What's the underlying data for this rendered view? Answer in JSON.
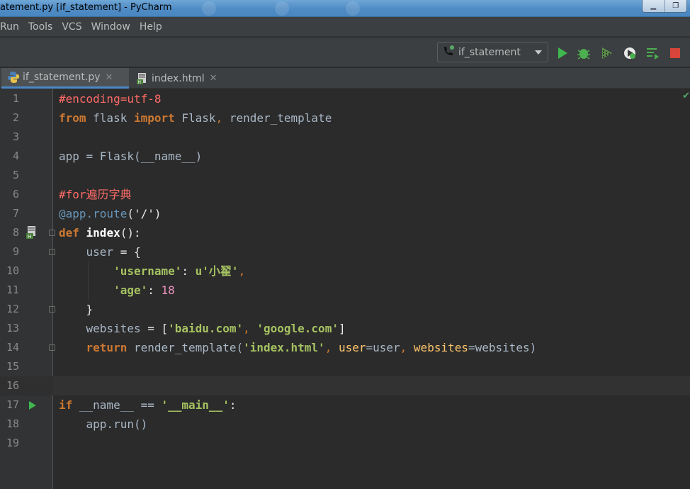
{
  "window": {
    "title": "atement.py [if_statement] - PyCharm",
    "controls": [
      "minimize",
      "restore"
    ]
  },
  "menu": [
    "Run",
    "Tools",
    "VCS",
    "Window",
    "Help"
  ],
  "toolbar": {
    "run_config": "if_statement",
    "icons": [
      "run-icon",
      "debug-icon",
      "coverage-icon",
      "profile-icon",
      "concurrency-icon",
      "stop-icon"
    ]
  },
  "tabs": [
    {
      "label": "if_statement.py",
      "active": true,
      "icon": "python-file-icon"
    },
    {
      "label": "index.html",
      "active": false,
      "icon": "html-file-icon"
    }
  ],
  "editor": {
    "current_line": 16,
    "lines": [
      {
        "n": "1",
        "tokens": [
          {
            "t": "#encoding=utf-8",
            "c": "cmt"
          }
        ]
      },
      {
        "n": "2",
        "tokens": [
          {
            "t": "from",
            "c": "kw"
          },
          {
            "t": " flask ",
            "c": "plain"
          },
          {
            "t": "import",
            "c": "kw"
          },
          {
            "t": " Flask",
            "c": "plain"
          },
          {
            "t": ", ",
            "c": "kw0"
          },
          {
            "t": "render_template",
            "c": "plain"
          }
        ]
      },
      {
        "n": "3",
        "tokens": []
      },
      {
        "n": "4",
        "tokens": [
          {
            "t": "app = Flask(__name__)",
            "c": "plain"
          }
        ]
      },
      {
        "n": "5",
        "tokens": []
      },
      {
        "n": "6",
        "tokens": [
          {
            "t": "#for遍历字典",
            "c": "cmt"
          }
        ]
      },
      {
        "n": "7",
        "tokens": [
          {
            "t": "@app.route",
            "c": "dec"
          },
          {
            "t": "('/')",
            "c": "plain2"
          }
        ]
      },
      {
        "n": "8",
        "tokens": [
          {
            "t": "def",
            "c": "kw"
          },
          {
            "t": " index",
            "c": "fnb"
          },
          {
            "t": "():",
            "c": "plain2"
          }
        ]
      },
      {
        "n": "9",
        "tokens": [
          {
            "t": "    user",
            "c": "plain"
          },
          {
            "t": " = {",
            "c": "plain2"
          }
        ]
      },
      {
        "n": "10",
        "tokens": [
          {
            "t": "        ",
            "c": "plain"
          },
          {
            "t": "'username'",
            "c": "strb"
          },
          {
            "t": ": ",
            "c": "plain2"
          },
          {
            "t": "u'小翟'",
            "c": "strb"
          },
          {
            "t": ",",
            "c": "kw0"
          }
        ]
      },
      {
        "n": "11",
        "tokens": [
          {
            "t": "        ",
            "c": "plain"
          },
          {
            "t": "'age'",
            "c": "strb"
          },
          {
            "t": ": ",
            "c": "plain2"
          },
          {
            "t": "18",
            "c": "num"
          }
        ]
      },
      {
        "n": "12",
        "tokens": [
          {
            "t": "    }",
            "c": "plain2"
          }
        ]
      },
      {
        "n": "13",
        "tokens": [
          {
            "t": "    websites",
            "c": "plain"
          },
          {
            "t": " = [",
            "c": "plain2"
          },
          {
            "t": "'baidu.com'",
            "c": "strb"
          },
          {
            "t": ", ",
            "c": "kw0"
          },
          {
            "t": "'google.com'",
            "c": "strb"
          },
          {
            "t": "]",
            "c": "plain2"
          }
        ]
      },
      {
        "n": "14",
        "tokens": [
          {
            "t": "    ",
            "c": "plain"
          },
          {
            "t": "return",
            "c": "kw"
          },
          {
            "t": " render_template(",
            "c": "plain"
          },
          {
            "t": "'index.html'",
            "c": "strb"
          },
          {
            "t": ", ",
            "c": "kw0"
          },
          {
            "t": "user",
            "c": "param"
          },
          {
            "t": "=user",
            "c": "plain"
          },
          {
            "t": ", ",
            "c": "kw0"
          },
          {
            "t": "websites",
            "c": "param"
          },
          {
            "t": "=websites)",
            "c": "plain"
          }
        ]
      },
      {
        "n": "15",
        "tokens": []
      },
      {
        "n": "16",
        "tokens": []
      },
      {
        "n": "17",
        "tokens": [
          {
            "t": "if",
            "c": "kw"
          },
          {
            "t": " __name__ == ",
            "c": "plain"
          },
          {
            "t": "'__main__'",
            "c": "strb"
          },
          {
            "t": ":",
            "c": "plain2"
          }
        ]
      },
      {
        "n": "18",
        "tokens": [
          {
            "t": "    app.run()",
            "c": "plain"
          }
        ]
      },
      {
        "n": "19",
        "tokens": []
      }
    ]
  },
  "colors": {
    "keyword": "#cc7832",
    "comment": "#ff6b68",
    "string": "#a5c261",
    "number": "#ed94c0",
    "decorator": "#6897bb",
    "text": "#a9b7c6",
    "background": "#2b2b2b"
  }
}
